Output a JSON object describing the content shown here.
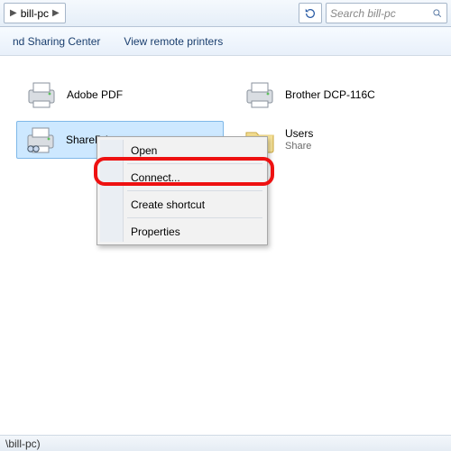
{
  "addressbar": {
    "crumb": "bill-pc",
    "search_placeholder": "Search bill-pc"
  },
  "toolbar": {
    "link1": "nd Sharing Center",
    "link2": "View remote printers"
  },
  "items": {
    "adobe": {
      "label": "Adobe PDF"
    },
    "brother": {
      "label": "Brother DCP-116C"
    },
    "shareprinter": {
      "label": "SharePrinter"
    },
    "users": {
      "label": "Users",
      "sub": "Share"
    }
  },
  "contextmenu": {
    "open": "Open",
    "connect": "Connect...",
    "shortcut": "Create shortcut",
    "properties": "Properties"
  },
  "statusbar": {
    "text": "\\bill-pc)"
  }
}
